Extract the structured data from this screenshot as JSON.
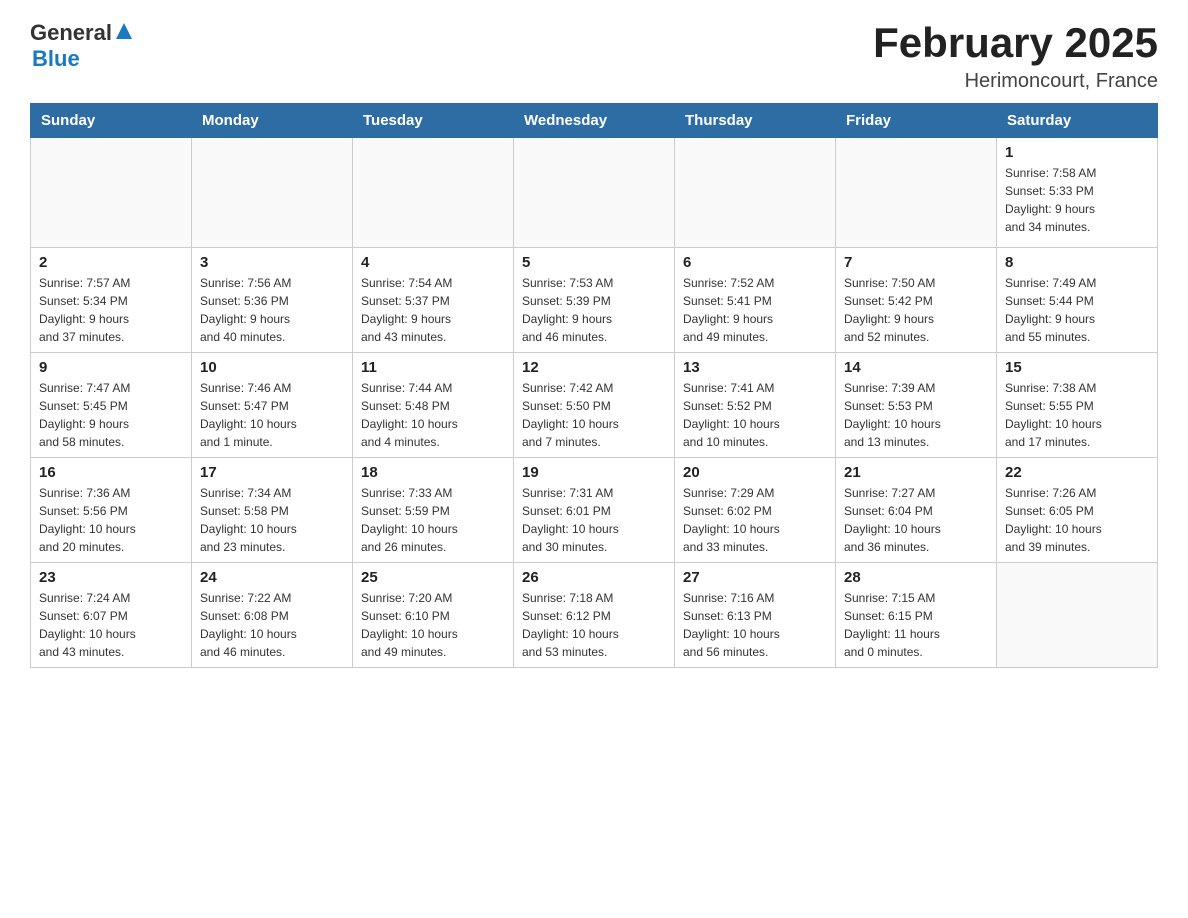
{
  "header": {
    "logo": {
      "general": "General",
      "triangle": "▲",
      "blue": "Blue"
    },
    "title": "February 2025",
    "location": "Herimoncourt, France"
  },
  "days_of_week": [
    "Sunday",
    "Monday",
    "Tuesday",
    "Wednesday",
    "Thursday",
    "Friday",
    "Saturday"
  ],
  "weeks": [
    [
      {
        "day": "",
        "info": ""
      },
      {
        "day": "",
        "info": ""
      },
      {
        "day": "",
        "info": ""
      },
      {
        "day": "",
        "info": ""
      },
      {
        "day": "",
        "info": ""
      },
      {
        "day": "",
        "info": ""
      },
      {
        "day": "1",
        "info": "Sunrise: 7:58 AM\nSunset: 5:33 PM\nDaylight: 9 hours\nand 34 minutes."
      }
    ],
    [
      {
        "day": "2",
        "info": "Sunrise: 7:57 AM\nSunset: 5:34 PM\nDaylight: 9 hours\nand 37 minutes."
      },
      {
        "day": "3",
        "info": "Sunrise: 7:56 AM\nSunset: 5:36 PM\nDaylight: 9 hours\nand 40 minutes."
      },
      {
        "day": "4",
        "info": "Sunrise: 7:54 AM\nSunset: 5:37 PM\nDaylight: 9 hours\nand 43 minutes."
      },
      {
        "day": "5",
        "info": "Sunrise: 7:53 AM\nSunset: 5:39 PM\nDaylight: 9 hours\nand 46 minutes."
      },
      {
        "day": "6",
        "info": "Sunrise: 7:52 AM\nSunset: 5:41 PM\nDaylight: 9 hours\nand 49 minutes."
      },
      {
        "day": "7",
        "info": "Sunrise: 7:50 AM\nSunset: 5:42 PM\nDaylight: 9 hours\nand 52 minutes."
      },
      {
        "day": "8",
        "info": "Sunrise: 7:49 AM\nSunset: 5:44 PM\nDaylight: 9 hours\nand 55 minutes."
      }
    ],
    [
      {
        "day": "9",
        "info": "Sunrise: 7:47 AM\nSunset: 5:45 PM\nDaylight: 9 hours\nand 58 minutes."
      },
      {
        "day": "10",
        "info": "Sunrise: 7:46 AM\nSunset: 5:47 PM\nDaylight: 10 hours\nand 1 minute."
      },
      {
        "day": "11",
        "info": "Sunrise: 7:44 AM\nSunset: 5:48 PM\nDaylight: 10 hours\nand 4 minutes."
      },
      {
        "day": "12",
        "info": "Sunrise: 7:42 AM\nSunset: 5:50 PM\nDaylight: 10 hours\nand 7 minutes."
      },
      {
        "day": "13",
        "info": "Sunrise: 7:41 AM\nSunset: 5:52 PM\nDaylight: 10 hours\nand 10 minutes."
      },
      {
        "day": "14",
        "info": "Sunrise: 7:39 AM\nSunset: 5:53 PM\nDaylight: 10 hours\nand 13 minutes."
      },
      {
        "day": "15",
        "info": "Sunrise: 7:38 AM\nSunset: 5:55 PM\nDaylight: 10 hours\nand 17 minutes."
      }
    ],
    [
      {
        "day": "16",
        "info": "Sunrise: 7:36 AM\nSunset: 5:56 PM\nDaylight: 10 hours\nand 20 minutes."
      },
      {
        "day": "17",
        "info": "Sunrise: 7:34 AM\nSunset: 5:58 PM\nDaylight: 10 hours\nand 23 minutes."
      },
      {
        "day": "18",
        "info": "Sunrise: 7:33 AM\nSunset: 5:59 PM\nDaylight: 10 hours\nand 26 minutes."
      },
      {
        "day": "19",
        "info": "Sunrise: 7:31 AM\nSunset: 6:01 PM\nDaylight: 10 hours\nand 30 minutes."
      },
      {
        "day": "20",
        "info": "Sunrise: 7:29 AM\nSunset: 6:02 PM\nDaylight: 10 hours\nand 33 minutes."
      },
      {
        "day": "21",
        "info": "Sunrise: 7:27 AM\nSunset: 6:04 PM\nDaylight: 10 hours\nand 36 minutes."
      },
      {
        "day": "22",
        "info": "Sunrise: 7:26 AM\nSunset: 6:05 PM\nDaylight: 10 hours\nand 39 minutes."
      }
    ],
    [
      {
        "day": "23",
        "info": "Sunrise: 7:24 AM\nSunset: 6:07 PM\nDaylight: 10 hours\nand 43 minutes."
      },
      {
        "day": "24",
        "info": "Sunrise: 7:22 AM\nSunset: 6:08 PM\nDaylight: 10 hours\nand 46 minutes."
      },
      {
        "day": "25",
        "info": "Sunrise: 7:20 AM\nSunset: 6:10 PM\nDaylight: 10 hours\nand 49 minutes."
      },
      {
        "day": "26",
        "info": "Sunrise: 7:18 AM\nSunset: 6:12 PM\nDaylight: 10 hours\nand 53 minutes."
      },
      {
        "day": "27",
        "info": "Sunrise: 7:16 AM\nSunset: 6:13 PM\nDaylight: 10 hours\nand 56 minutes."
      },
      {
        "day": "28",
        "info": "Sunrise: 7:15 AM\nSunset: 6:15 PM\nDaylight: 11 hours\nand 0 minutes."
      },
      {
        "day": "",
        "info": ""
      }
    ]
  ]
}
